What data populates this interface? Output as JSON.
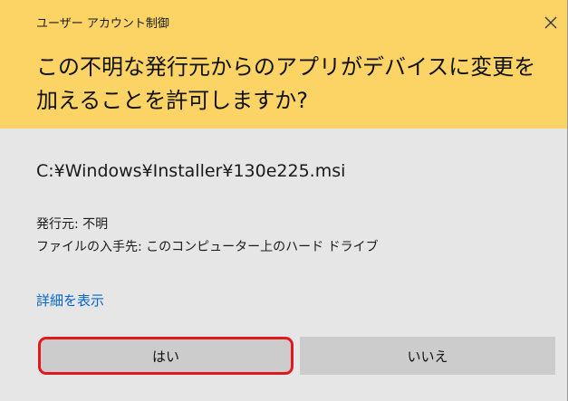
{
  "window": {
    "title": "ユーザー アカウント制御"
  },
  "header": {
    "question": "この不明な発行元からのアプリがデバイスに変更を加えることを許可しますか?",
    "background_color": "#fcd466"
  },
  "program": {
    "path": "C:¥Windows¥Installer¥130e225.msi",
    "publisher": "発行元: 不明",
    "origin": "ファイルの入手先: このコンピューター上のハード ドライブ"
  },
  "details_link": "詳細を表示",
  "buttons": {
    "yes": "はい",
    "no": "いいえ"
  },
  "icons": {
    "close": "close-icon"
  },
  "colors": {
    "highlight": "#e0191d",
    "link": "#0066cc",
    "body_background": "#e6e6e6",
    "button_background": "#cccccc"
  }
}
